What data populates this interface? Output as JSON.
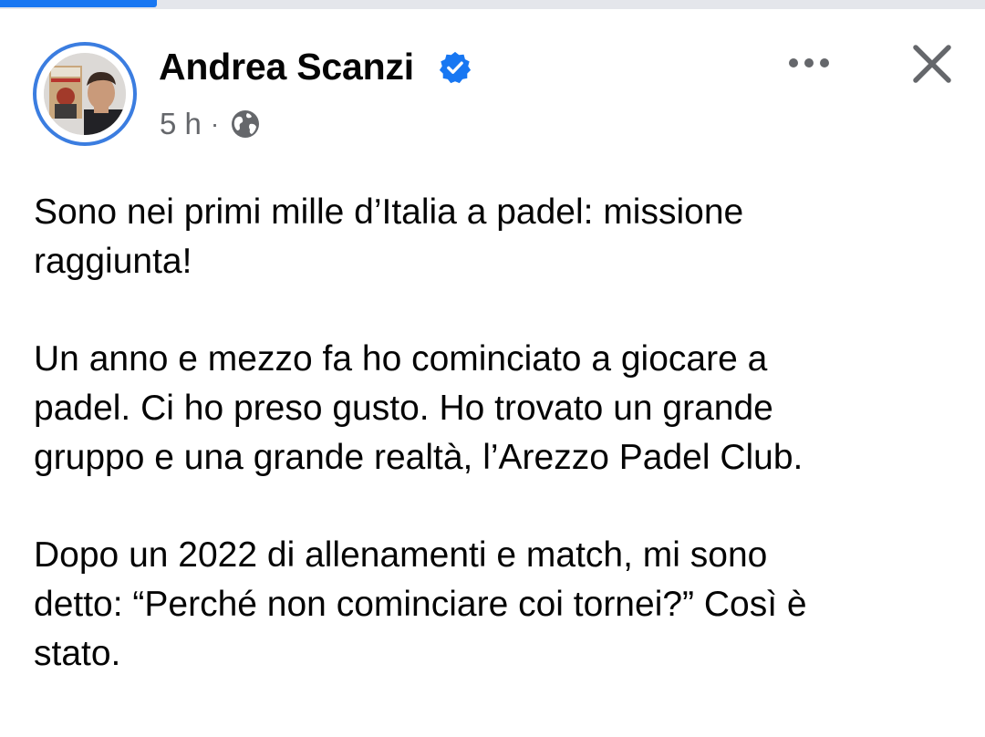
{
  "post": {
    "author_name": "Andrea Scanzi",
    "verified": true,
    "timestamp": "5 h",
    "separator": "·",
    "audience_icon": "globe-icon",
    "paragraphs": [
      "Sono nei primi mille d’Italia a padel: missione\nraggiunta!",
      "Un anno e mezzo fa ho cominciato a giocare a\npadel. Ci ho preso gusto. Ho trovato un grande\ngruppo e una grande realtà, l’Arezzo Padel Club.",
      "Dopo un 2022 di allenamenti e match, mi sono\ndetto: “Perché non cominciare coi tornei?” Così è\nstato."
    ]
  },
  "icons": {
    "more": "more-horizontal-icon",
    "close": "close-icon",
    "verified": "verified-badge-icon"
  },
  "colors": {
    "accent": "#1877f2",
    "avatar_ring": "#3b7de0",
    "secondary_text": "#65676b",
    "primary_text": "#050505"
  }
}
